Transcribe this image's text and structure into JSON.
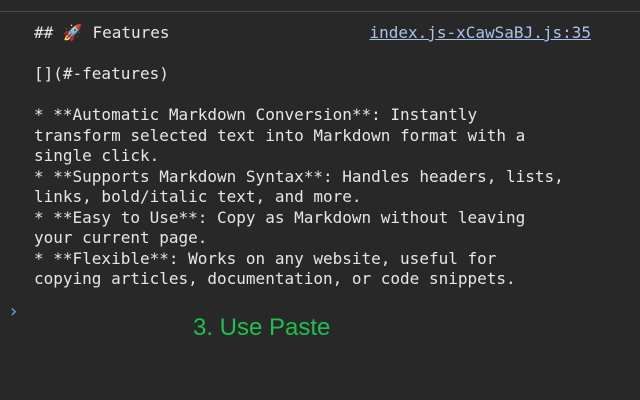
{
  "console": {
    "source_link": "index.js-xCawSaBJ.js:35",
    "lines": [
      "## 🚀 Features",
      "",
      "[](#-features)",
      "",
      "* **Automatic Markdown Conversion**: Instantly",
      "transform selected text into Markdown format with a",
      "single click.",
      "* **Supports Markdown Syntax**: Handles headers, lists,",
      "links, bold/italic text, and more.",
      "* **Easy to Use**: Copy as Markdown without leaving",
      "your current page.",
      "* **Flexible**: Works on any website, useful for",
      "copying articles, documentation, or code snippets."
    ],
    "prompt_symbol": "›"
  },
  "overlay": {
    "caption": "3. Use Paste"
  },
  "colors": {
    "background": "#282828",
    "text": "#e6e6e6",
    "link": "#a9c2ea",
    "prompt": "#6ea8ff",
    "caption": "#1fbf4f"
  }
}
